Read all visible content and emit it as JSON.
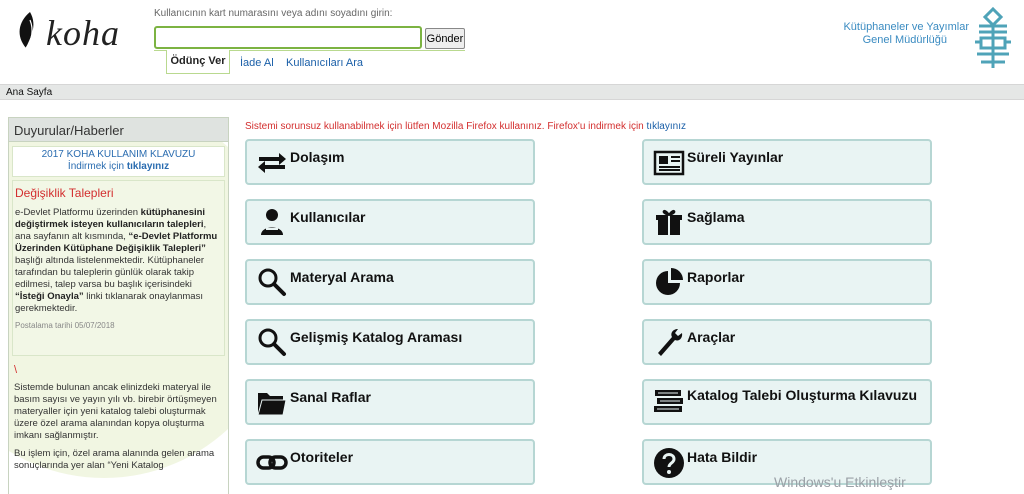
{
  "header": {
    "logo_text": "koha",
    "search_prompt": "Kullanıcının kart numarasını veya adını soyadını girin:",
    "search_value": "",
    "submit_label": "Gönder",
    "tabs": [
      "Ödünç Ver",
      "İade Al",
      "Kullanıcıları Ara"
    ],
    "org_name_line1": "Kütüphaneler ve Yayımlar",
    "org_name_line2": "Genel Müdürlüğü"
  },
  "breadcrumb": "Ana Sayfa",
  "announcements": {
    "title": "Duyurular/Haberler",
    "manual_line1": "2017 KOHA KULLANIM KLAVUZU",
    "manual_line2_prefix": "İndirmek için ",
    "manual_line2_link": "tıklayınız",
    "news_title": "Değişiklik Talepleri",
    "news_body": [
      {
        "t": "e-Devlet Platformu üzerinden ",
        "b": false
      },
      {
        "t": "kütüphanesini değiştirmek isteyen kullanıcıların talepleri",
        "b": true
      },
      {
        "t": ", ana sayfanın alt kısmında, ",
        "b": false
      },
      {
        "t": "“e-Devlet Platformu Üzerinden Kütüphane Değişiklik Talepleri”",
        "b": true
      },
      {
        "t": " başlığı altında listelenmektedir. Kütüphaneler tarafından bu  taleplerin günlük olarak takip edilmesi, talep varsa  bu    başlık içerisindeki ",
        "b": false
      },
      {
        "t": "“İsteği Onayla”",
        "b": true
      },
      {
        "t": " linki tıklanarak onaylanması gerekmektedir.",
        "b": false
      }
    ],
    "news_date": "Postalama tarihi 05/07/2018",
    "news2_mark": "\\",
    "news2_body": "Sistemde bulunan ancak elinizdeki materyal ile basım sayısı ve yayın yılı vb. birebir örtüşmeyen materyaller için yeni  katalog talebi oluşturmak üzere özel arama alanından  kopya oluşturma imkanı sağlanmıştır.",
    "news2_body2": "Bu işlem için,  özel arama alanında  gelen arama sonuçlarında yer alan  “Yeni Katalog"
  },
  "notice": {
    "text": "Sistemi sorunsuz kullanabilmek için lütfen Mozilla Firefox kullanınız. Firefox'u indirmek için ",
    "link": "tıklayınız"
  },
  "menu": [
    {
      "label": "Dolaşım",
      "icon": "circulation-arrows-icon"
    },
    {
      "label": "Süreli Yayınlar",
      "icon": "serials-newspaper-icon"
    },
    {
      "label": "Kullanıcılar",
      "icon": "patrons-person-icon"
    },
    {
      "label": "Sağlama",
      "icon": "acquisitions-gift-icon"
    },
    {
      "label": "Materyal Arama",
      "icon": "search-magnifier-icon"
    },
    {
      "label": "Raporlar",
      "icon": "reports-pie-icon"
    },
    {
      "label": "Gelişmiş Katalog Araması",
      "icon": "advanced-search-magnifier-icon"
    },
    {
      "label": "Araçlar",
      "icon": "tools-wrench-icon"
    },
    {
      "label": "Sanal Raflar",
      "icon": "lists-folder-icon"
    },
    {
      "label": "Katalog Talebi Oluşturma Kılavuzu",
      "icon": "catalog-books-icon"
    },
    {
      "label": "Otoriteler",
      "icon": "authorities-link-icon"
    },
    {
      "label": "Hata Bildir",
      "icon": "help-question-icon"
    }
  ],
  "watermark": "Windows'u Etkinleştir"
}
